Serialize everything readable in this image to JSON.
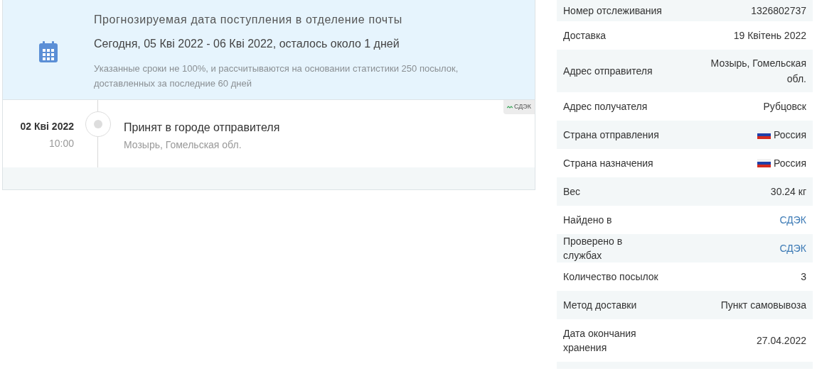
{
  "forecast": {
    "title": "Прогнозируемая дата поступления в отделение почты",
    "range": "Сегодня, 05 Кві 2022 - 06 Кві 2022, осталось около 1 дней",
    "note": "Указанные сроки не 100%, и рассчитываются на основании статистики 250 посылок, доставленных за последние 60 дней"
  },
  "events": [
    {
      "date": "02 Кві 2022",
      "time": "10:00",
      "status": "Принят в городе отправителя",
      "location": "Мозырь, Гомельская обл.",
      "carrier": "СДЭК"
    }
  ],
  "details": [
    {
      "label": "Номер отслеживания",
      "value": "1326802737",
      "kind": "text"
    },
    {
      "label": "Доставка",
      "value": "19 Квітень 2022",
      "kind": "text"
    },
    {
      "label": "Адрес отправителя",
      "value": "Мозырь, Гомельская обл.",
      "kind": "text"
    },
    {
      "label": "Адрес получателя",
      "value": "Рубцовск",
      "kind": "text"
    },
    {
      "label": "Страна отправления",
      "value": "Россия",
      "kind": "flag"
    },
    {
      "label": "Страна назначения",
      "value": "Россия",
      "kind": "flag"
    },
    {
      "label": "Вес",
      "value": "30.24 кг",
      "kind": "text"
    },
    {
      "label": "Найдено в",
      "value": "СДЭК",
      "kind": "link"
    },
    {
      "label": "Проверено в службах",
      "value": "СДЭК",
      "kind": "link"
    },
    {
      "label": "Количество посылок",
      "value": "3",
      "kind": "text"
    },
    {
      "label": "Метод доставки",
      "value": "Пункт самовывоза",
      "kind": "text"
    },
    {
      "label": "Дата окончания хранения",
      "value": "27.04.2022",
      "kind": "text"
    }
  ]
}
